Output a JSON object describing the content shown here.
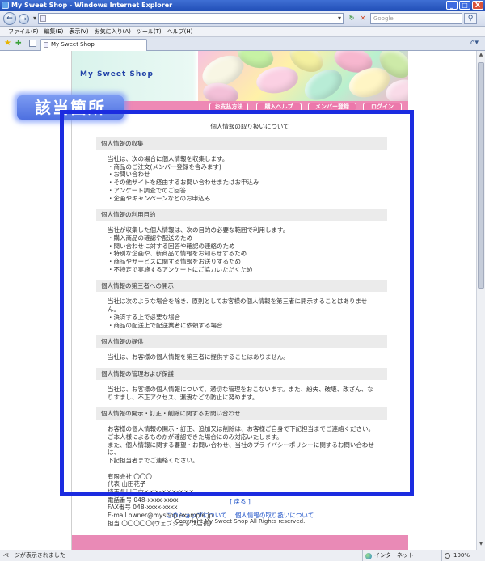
{
  "window": {
    "title": "My Sweet Shop - Windows Internet Explorer",
    "controls": [
      "_",
      "□",
      "X"
    ]
  },
  "addressbar": {
    "url": "",
    "search_placeholder": "Google"
  },
  "menubar": [
    "ファイル(F)",
    "編集(E)",
    "表示(V)",
    "お気に入り(A)",
    "ツール(T)",
    "ヘルプ(H)"
  ],
  "tab": {
    "label": "My Sweet Shop"
  },
  "site": {
    "shop_name": "My Sweet Shop",
    "nav": [
      "お支払方法",
      "購入ヘルプ",
      "メンバー登録",
      "ログイン"
    ],
    "callout": "該当箇所"
  },
  "doc": {
    "title": "個人情報の取り扱いについて",
    "sections": [
      {
        "heading": "個人情報の収集",
        "body": "当社は、次の場合に個人情報を収集します。\n・商品のご注文(メンバー登録を含みます)\n・お問い合わせ\n・その他サイトを経由するお問い合わせまたはお申込み\n・アンケート調査でのご回答\n・企画やキャンペーンなどのお申込み"
      },
      {
        "heading": "個人情報の利用目的",
        "body": "当社が収集した個人情報は、次の目的の必要な範囲で利用します。\n・購入商品の確認や配送のため\n・問い合わせに対する回答や確認の連絡のため\n・特別な企画や、新商品の情報をお知らせするため\n・商品やサービスに関する情報をお送りするため\n・不特定で実施するアンケートにご協力いただくため"
      },
      {
        "heading": "個人情報の第三者への開示",
        "body": "当社は次のような場合を除き、原則としてお客様の個人情報を第三者に開示することはありません。\n・決済する上で必要な場合\n・商品の配送上で配送業者に依頼する場合"
      },
      {
        "heading": "個人情報の提供",
        "body": "当社は、お客様の個人情報を第三者に提供することはありません。"
      },
      {
        "heading": "個人情報の管理および保護",
        "body": "当社は、お客様の個人情報について、適切な管理をおこないます。また、紛失、破壊、改ざん、なりすまし、不正アクセス、漏洩などの防止に努めます。"
      },
      {
        "heading": "個人情報の開示・訂正・削除に関するお問い合わせ",
        "body": "お客様の個人情報の開示・訂正、追加又は削除は、お客様ご自身で下記担当までご連絡ください。\nご本人様によるものかが確認できた場合にのみ対応いたします。\nまた、個人情報に関する要望・お問い合わせ、当社のプライバシーポリシーに関するお問い合わせは、\n下記担当者までご連絡ください。\n\n有限会社 〇〇〇\n代表 山田花子\n埼玉県川口市×××-×××-×××\n電話番号 048-xxxx-xxxx\nFAX番号 048-xxxx-xxxx\nE-mail owner@myshop.example.jp\n担当 〇〇〇〇〇(ウェブショップ店長)"
      }
    ]
  },
  "footer": {
    "back": "[ 戻る ]",
    "links": [
      "このショップについて",
      "個人情報の取り扱いについて"
    ],
    "copyright": "Copyright My Sweet Shop All Rights reserved."
  },
  "statusbar": {
    "text": "ページが表示されました",
    "zone": "インターネット",
    "zoom": "100%"
  },
  "colors": {
    "frame": "#1b2be0",
    "nav_pink": "#ee89b5",
    "link": "#1a4fc7"
  }
}
